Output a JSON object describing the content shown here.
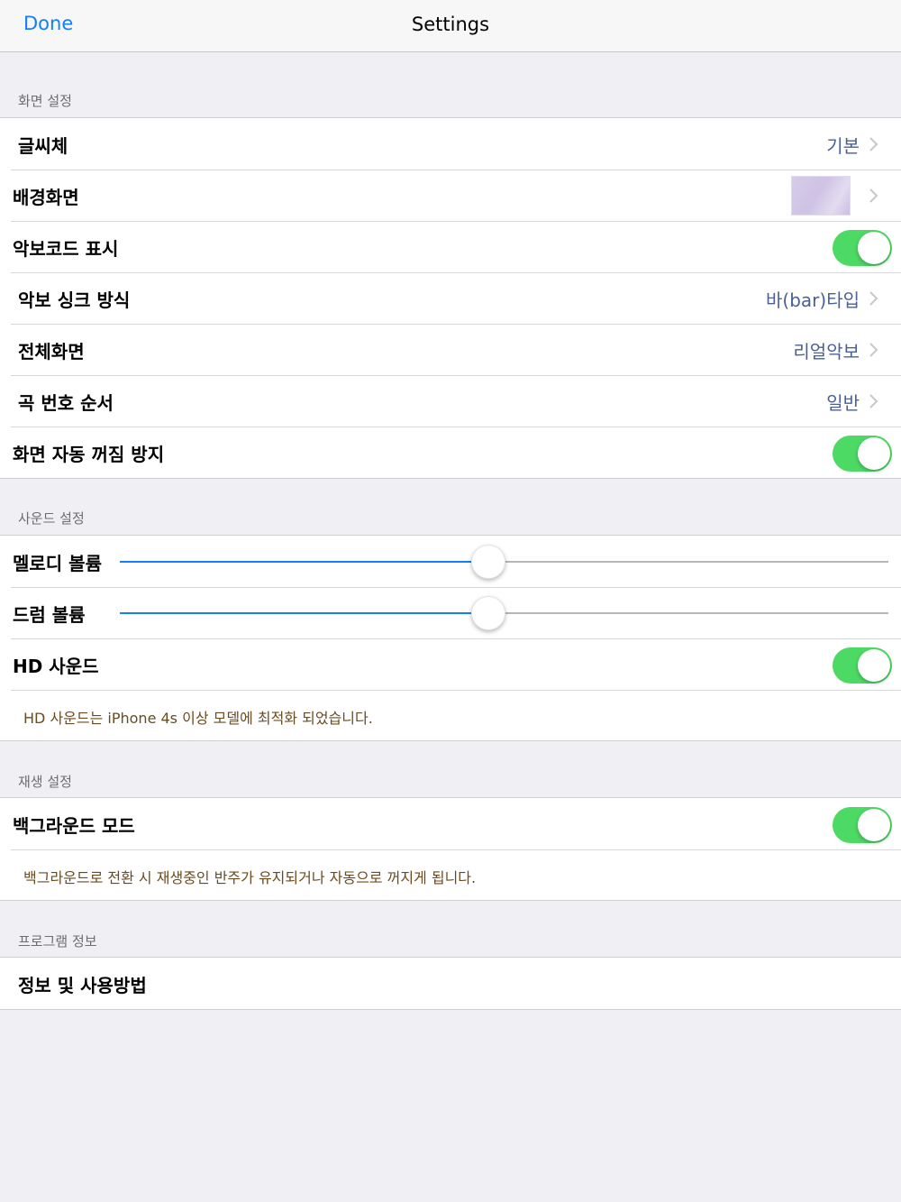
{
  "navbar": {
    "done_label": "Done",
    "title": "Settings"
  },
  "display": {
    "header": "화면 설정",
    "font": {
      "label": "글씨체",
      "value": "기본"
    },
    "wallpaper": {
      "label": "배경화면"
    },
    "score_code": {
      "label": "악보코드 표시",
      "enabled": true
    },
    "sync_mode": {
      "label": "악보 싱크 방식",
      "value": "바(bar)타입"
    },
    "fullscreen": {
      "label": "전체화면",
      "value": "리얼악보"
    },
    "song_order": {
      "label": "곡 번호 순서",
      "value": "일반"
    },
    "auto_lock": {
      "label": "화면 자동 꺼짐 방지",
      "enabled": true
    }
  },
  "sound": {
    "header": "사운드 설정",
    "melody_volume": {
      "label": "멜로디 볼륨",
      "level": 0.48
    },
    "drum_volume": {
      "label": "드럼 볼륨",
      "level": 0.48
    },
    "hd_sound": {
      "label": "HD 사운드",
      "enabled": true
    },
    "note": "HD 사운드는 iPhone 4s 이상 모델에 최적화 되었습니다."
  },
  "playback": {
    "header": "재생 설정",
    "background_mode": {
      "label": "백그라운드 모드",
      "enabled": true
    },
    "note": "백그라운드로 전환 시 재생중인 반주가 유지되거나 자동으로 꺼지게 됩니다."
  },
  "program": {
    "header": "프로그램 정보",
    "info": {
      "label": "정보 및 사용방법"
    }
  },
  "colors": {
    "accent": "#147efb",
    "toggle_on": "#4cd964",
    "value_text": "#4a6196",
    "note_text": "#6b4b1e"
  }
}
